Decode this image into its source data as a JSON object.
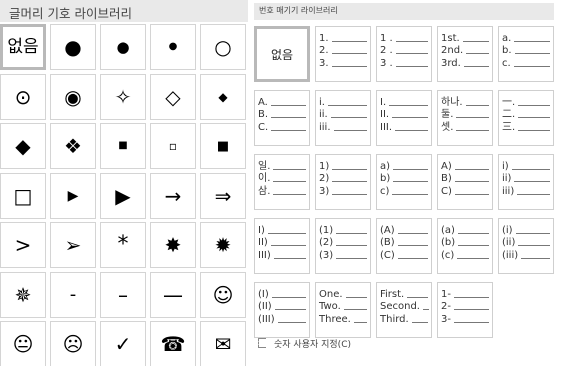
{
  "bullet_library": {
    "title": "글머리 기호 라이브러리",
    "items": [
      {
        "name": "none",
        "glyph": "없음",
        "selected": true
      },
      {
        "name": "large-filled-circle",
        "glyph": "●"
      },
      {
        "name": "medium-filled-circle",
        "glyph": "●"
      },
      {
        "name": "small-filled-circle",
        "glyph": "●"
      },
      {
        "name": "hollow-circle",
        "glyph": "○"
      },
      {
        "name": "circled-dot",
        "glyph": "⊙"
      },
      {
        "name": "fisheye",
        "glyph": "◉"
      },
      {
        "name": "four-point-star",
        "glyph": "✧"
      },
      {
        "name": "hollow-diamond",
        "glyph": "◇"
      },
      {
        "name": "small-filled-diamond",
        "glyph": "◆"
      },
      {
        "name": "filled-diamond",
        "glyph": "◆"
      },
      {
        "name": "diamond-cluster",
        "glyph": "❖"
      },
      {
        "name": "small-filled-square",
        "glyph": "■"
      },
      {
        "name": "small-hollow-square",
        "glyph": "▫"
      },
      {
        "name": "filled-square",
        "glyph": "■"
      },
      {
        "name": "hollow-square",
        "glyph": "□"
      },
      {
        "name": "small-triangle-right",
        "glyph": "▶"
      },
      {
        "name": "triangle-right",
        "glyph": "▶"
      },
      {
        "name": "right-arrow",
        "glyph": "→"
      },
      {
        "name": "double-right-arrow",
        "glyph": "⇒"
      },
      {
        "name": "greater-than",
        "glyph": ">"
      },
      {
        "name": "arrowhead",
        "glyph": "➢"
      },
      {
        "name": "asterisk",
        "glyph": "*"
      },
      {
        "name": "eight-point-star",
        "glyph": "✸"
      },
      {
        "name": "twelve-point-star",
        "glyph": "✹"
      },
      {
        "name": "snowflake-star",
        "glyph": "✵"
      },
      {
        "name": "short-dash",
        "glyph": "-"
      },
      {
        "name": "en-dash",
        "glyph": "–"
      },
      {
        "name": "em-dash",
        "glyph": "—"
      },
      {
        "name": "smiley-face",
        "glyph": "☺"
      },
      {
        "name": "neutral-face",
        "glyph": "😐"
      },
      {
        "name": "frowning-face",
        "glyph": "☹"
      },
      {
        "name": "check-mark",
        "glyph": "✓"
      },
      {
        "name": "telephone",
        "glyph": "☎"
      },
      {
        "name": "envelope",
        "glyph": "✉"
      }
    ]
  },
  "numbering_library": {
    "title": "번호 매기기 라이브러리",
    "items": [
      {
        "name": "none",
        "text": "없음",
        "selected": true,
        "lines": []
      },
      {
        "name": "decimal-dot",
        "lines": [
          "1.",
          "2.",
          "3."
        ]
      },
      {
        "name": "decimal-dot-spaced",
        "lines": [
          "1 .",
          "2 .",
          "3 ."
        ]
      },
      {
        "name": "ordinal",
        "lines": [
          "1st.",
          "2nd.",
          "3rd."
        ]
      },
      {
        "name": "lower-alpha-dot",
        "lines": [
          "a.",
          "b.",
          "c."
        ]
      },
      {
        "name": "upper-alpha-dot",
        "lines": [
          "A.",
          "B.",
          "C."
        ]
      },
      {
        "name": "lower-roman-dot",
        "lines": [
          "i.",
          "ii.",
          "iii."
        ]
      },
      {
        "name": "upper-roman-dot",
        "lines": [
          "I.",
          "II.",
          "III."
        ]
      },
      {
        "name": "korean-native-dot",
        "lines": [
          "하나.",
          "둘.",
          "셋."
        ]
      },
      {
        "name": "korean-hanja-dot",
        "lines": [
          "一.",
          "二.",
          "三."
        ]
      },
      {
        "name": "korean-sino-dot",
        "lines": [
          "일.",
          "이.",
          "삼."
        ]
      },
      {
        "name": "decimal-paren",
        "lines": [
          "1)",
          "2)",
          "3)"
        ]
      },
      {
        "name": "lower-alpha-paren",
        "lines": [
          "a)",
          "b)",
          "c)"
        ]
      },
      {
        "name": "upper-alpha-paren",
        "lines": [
          "A)",
          "B)",
          "C)"
        ]
      },
      {
        "name": "lower-roman-paren",
        "lines": [
          "i)",
          "ii)",
          "iii)"
        ]
      },
      {
        "name": "upper-roman-paren",
        "lines": [
          "I)",
          "II)",
          "III)"
        ]
      },
      {
        "name": "decimal-parens",
        "lines": [
          "(1)",
          "(2)",
          "(3)"
        ]
      },
      {
        "name": "upper-alpha-parens",
        "lines": [
          "(A)",
          "(B)",
          "(C)"
        ]
      },
      {
        "name": "lower-alpha-parens",
        "lines": [
          "(a)",
          "(b)",
          "(c)"
        ]
      },
      {
        "name": "lower-roman-parens",
        "lines": [
          "(i)",
          "(ii)",
          "(iii)"
        ]
      },
      {
        "name": "upper-roman-parens",
        "lines": [
          "(I)",
          "(II)",
          "(III)"
        ]
      },
      {
        "name": "cardinal-words",
        "lines": [
          "One.",
          "Two.",
          "Three."
        ]
      },
      {
        "name": "ordinal-words",
        "lines": [
          "First.",
          "Second.",
          "Third."
        ]
      },
      {
        "name": "decimal-dash",
        "lines": [
          "1-",
          "2-",
          "3-"
        ]
      }
    ]
  },
  "custom_action": {
    "label": "숫자 사용자 지정(C)"
  }
}
